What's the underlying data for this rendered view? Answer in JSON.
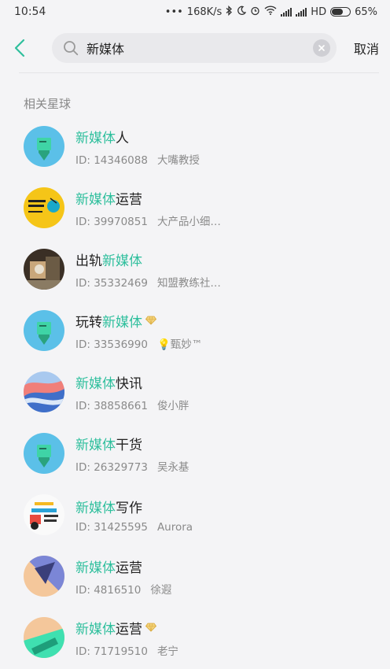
{
  "status_bar": {
    "time": "10:54",
    "dots": "•••",
    "speed": "168K/s",
    "hd": "HD",
    "battery": "65%",
    "battery_level": 0.65
  },
  "search": {
    "query": "新媒体",
    "cancel_label": "取消"
  },
  "section_title": "相关星球",
  "results": [
    {
      "hl": "新媒体",
      "name_rest": "人",
      "name_prefix": "",
      "id_text": "ID: 14346088",
      "owner": "大嘴教授",
      "gem": false,
      "avatar": "teal-screen"
    },
    {
      "hl": "新媒体",
      "name_rest": "运营",
      "name_prefix": "",
      "id_text": "ID: 39970851",
      "owner": "大产品小细…",
      "gem": false,
      "avatar": "yellow-study"
    },
    {
      "hl": "新媒体",
      "name_rest": "",
      "name_prefix": "出轨",
      "id_text": "ID: 35332469",
      "owner": "知盟教练社…",
      "gem": false,
      "avatar": "photo"
    },
    {
      "hl": "新媒体",
      "name_rest": "",
      "name_prefix": "玩转",
      "id_text": "ID: 33536990",
      "owner": "💡甄妙™",
      "gem": true,
      "avatar": "teal-screen"
    },
    {
      "hl": "新媒体",
      "name_rest": "快讯",
      "name_prefix": "",
      "id_text": "ID: 38858661",
      "owner": "俊小胖",
      "gem": false,
      "avatar": "blue-red-wave"
    },
    {
      "hl": "新媒体",
      "name_rest": "干货",
      "name_prefix": "",
      "id_text": "ID: 26329773",
      "owner": "吴永基",
      "gem": false,
      "avatar": "teal-screen"
    },
    {
      "hl": "新媒体",
      "name_rest": "写作",
      "name_prefix": "",
      "id_text": "ID: 31425595",
      "owner": "Aurora",
      "gem": false,
      "avatar": "white-poster"
    },
    {
      "hl": "新媒体",
      "name_rest": "运营",
      "name_prefix": "",
      "id_text": "ID: 4816510",
      "owner": "徐遐",
      "gem": false,
      "avatar": "purple-triangle"
    },
    {
      "hl": "新媒体",
      "name_rest": "运营",
      "name_prefix": "",
      "id_text": "ID: 71719510",
      "owner": "老宁",
      "gem": true,
      "avatar": "mint-peach"
    }
  ],
  "colors": {
    "accent": "#2fbf9d",
    "background": "#f4f4f6"
  }
}
